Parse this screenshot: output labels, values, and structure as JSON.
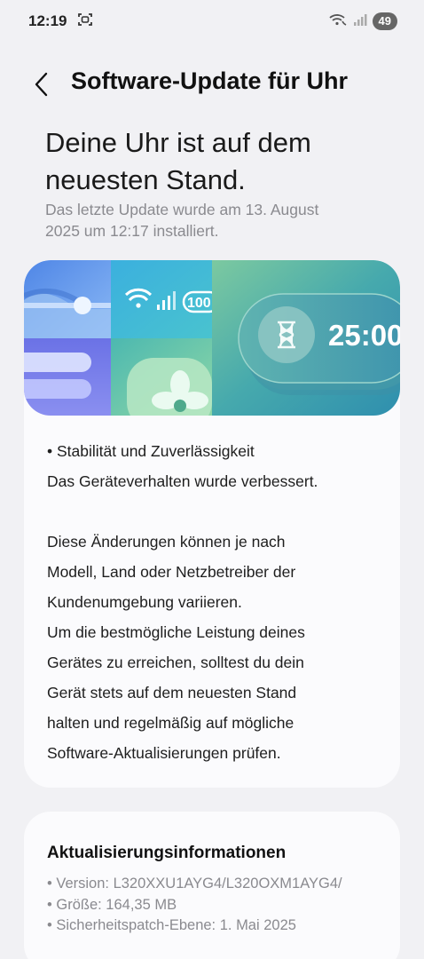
{
  "status_bar": {
    "time": "12:19",
    "battery": "49",
    "icons": [
      "screenshot-icon",
      "wifi-calling-icon",
      "signal-icon"
    ]
  },
  "header": {
    "title": "Software-Update für Uhr"
  },
  "main": {
    "headline_line1": "Deine Uhr ist auf dem",
    "headline_line2": "neuesten Stand.",
    "subline_line1": "Das letzte Update wurde am 13. August",
    "subline_line2": "2025 um 12:17 installiert."
  },
  "banner": {
    "battery_text": "100",
    "timer_text": "25:00",
    "icons": [
      "wifi-icon",
      "signal-icon",
      "hourglass-icon",
      "fan-icon"
    ],
    "colors": {
      "blue": "#5b8de8",
      "teal": "#3fb5c2",
      "green": "#7dc9a4"
    }
  },
  "details": {
    "line1": "• Stabilität und Zuverlässigkeit",
    "line2": "Das Geräteverhalten wurde verbessert.",
    "line3": "Diese Änderungen können je nach",
    "line4": "Modell, Land oder Netzbetreiber der",
    "line5": "Kundenumgebung variieren.",
    "line6": "Um die bestmögliche Leistung deines",
    "line7": "Gerätes zu erreichen, solltest du dein",
    "line8": "Gerät stets auf dem neuesten Stand",
    "line9": "halten und regelmäßig auf mögliche",
    "line10": "Software-Aktualisierungen prüfen."
  },
  "update_info": {
    "title": "Aktualisierungsinformationen",
    "version": "• Version: L320XXU1AYG4/L320OXM1AYG4/",
    "size": "• Größe: 164,35 MB",
    "patch": "• Sicherheitspatch-Ebene: 1. Mai 2025"
  }
}
